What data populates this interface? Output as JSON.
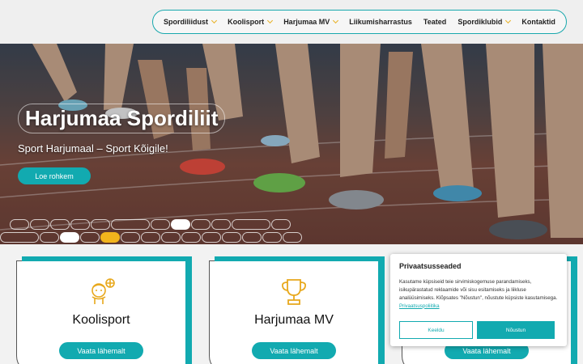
{
  "nav": {
    "items": [
      {
        "label": "Spordiliidust",
        "dropdown": true
      },
      {
        "label": "Koolisport",
        "dropdown": true
      },
      {
        "label": "Harjumaa MV",
        "dropdown": true
      },
      {
        "label": "Liikumisharrastus",
        "dropdown": false
      },
      {
        "label": "Teated",
        "dropdown": false
      },
      {
        "label": "Spordiklubid",
        "dropdown": true
      },
      {
        "label": "Kontaktid",
        "dropdown": false
      }
    ]
  },
  "hero": {
    "title": "Harjumaa Spordiliit",
    "subtitle": "Sport Harjumaal – Sport Kõigile!",
    "button": "Loe rohkem"
  },
  "cards": [
    {
      "title": "Koolisport",
      "button": "Vaata lähemalt",
      "icon": "student-basketball-icon"
    },
    {
      "title": "Harjumaa MV",
      "button": "Vaata lähemalt",
      "icon": "trophy-icon"
    },
    {
      "title": "",
      "button": "Vaata lähemalt",
      "icon": ""
    }
  ],
  "cookie": {
    "title": "Privaatsusseaded",
    "text": "Kasutame küpsiseid teie sirvimiskogemuse parandamiseks, isikupärastatud reklaamide või sisu esitamiseks ja liikluse analüüsimiseks. Klõpsates \"Nõustun\", nõustute küpsiste kasutamisega.",
    "link": "Privaatsuspoliitika",
    "decline": "Keeldu",
    "accept": "Nõustun"
  },
  "colors": {
    "accent": "#12aab0",
    "highlight": "#f2b41c"
  }
}
